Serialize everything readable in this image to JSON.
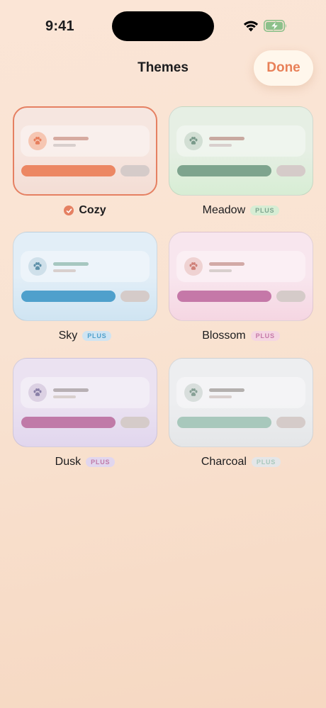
{
  "status": {
    "time": "9:41"
  },
  "header": {
    "title": "Themes",
    "done_label": "Done"
  },
  "colors": {
    "accent": "#e88058",
    "selected_border": "#e58062"
  },
  "themes": [
    {
      "name": "Cozy",
      "selected": true,
      "badge": "",
      "icon": "paw-icon",
      "bg_top": "#f6e6e0",
      "bg_bottom": "#f4ddd4",
      "primary": "#ec8763",
      "paw_bg": "#f6c6b2",
      "paw": "#e77e5c",
      "line": "#d6aaa0"
    },
    {
      "name": "Meadow",
      "selected": false,
      "badge": "PLUS",
      "icon": "paw-icon",
      "bg_top": "#e6efe4",
      "bg_bottom": "#d7edd4",
      "primary": "#7ea48e",
      "paw_bg": "#d2dfd4",
      "paw": "#799a8a",
      "line": "#c8a9a0"
    },
    {
      "name": "Sky",
      "selected": false,
      "badge": "PLUS",
      "icon": "paw-icon",
      "bg_top": "#e2eef7",
      "bg_bottom": "#cfe4f2",
      "primary": "#4fa0cc",
      "paw_bg": "#cfe0ea",
      "paw": "#5d90a8",
      "line": "#a6c7c0"
    },
    {
      "name": "Blossom",
      "selected": false,
      "badge": "PLUS",
      "icon": "paw-icon",
      "bg_top": "#f8e6ee",
      "bg_bottom": "#f5d6e2",
      "primary": "#c578a8",
      "paw_bg": "#efd2d2",
      "paw": "#cf8078",
      "line": "#d2a9a6"
    },
    {
      "name": "Dusk",
      "selected": false,
      "badge": "PLUS",
      "icon": "paw-icon",
      "bg_top": "#ebe2f1",
      "bg_bottom": "#e1d6ee",
      "primary": "#c07aa8",
      "paw_bg": "#dcd1e3",
      "paw": "#8a80a8",
      "line": "#b8b0b4"
    },
    {
      "name": "Charcoal",
      "selected": false,
      "badge": "PLUS",
      "icon": "paw-icon",
      "bg_top": "#edeef0",
      "bg_bottom": "#e4e6e8",
      "primary": "#a8c8bc",
      "paw_bg": "#d8dedc",
      "paw": "#86a095",
      "line": "#b4b0ae"
    }
  ]
}
